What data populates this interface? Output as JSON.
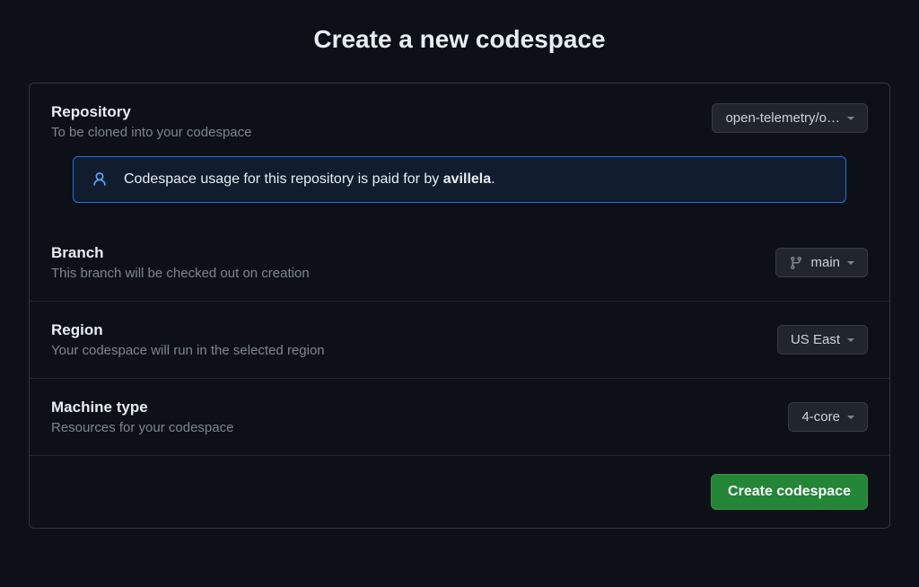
{
  "title": "Create a new codespace",
  "repository": {
    "label": "Repository",
    "desc": "To be cloned into your codespace",
    "selected": "open-telemetry/o…"
  },
  "notice": {
    "prefix": "Codespace usage for this repository is paid for by ",
    "payer": "avillela",
    "suffix": "."
  },
  "branch": {
    "label": "Branch",
    "desc": "This branch will be checked out on creation",
    "selected": "main"
  },
  "region": {
    "label": "Region",
    "desc": "Your codespace will run in the selected region",
    "selected": "US East"
  },
  "machine": {
    "label": "Machine type",
    "desc": "Resources for your codespace",
    "selected": "4-core"
  },
  "submit": "Create codespace"
}
